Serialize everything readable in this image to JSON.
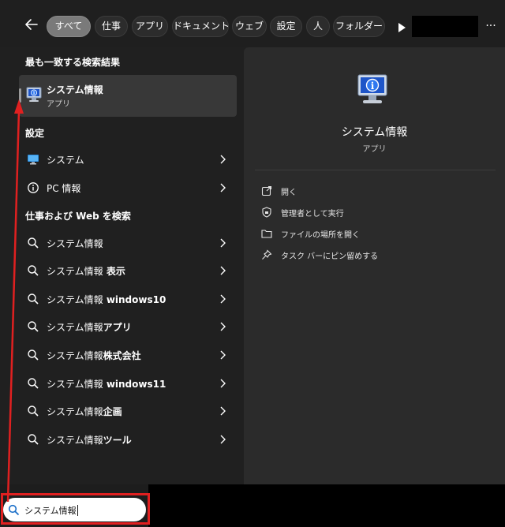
{
  "filters": {
    "back_icon": "arrow-left-icon",
    "chips": [
      {
        "label": "すべて",
        "active": true
      },
      {
        "label": "仕事",
        "active": false
      },
      {
        "label": "アプリ",
        "active": false
      },
      {
        "label": "ドキュメント",
        "active": false
      },
      {
        "label": "ウェブ",
        "active": false
      },
      {
        "label": "設定",
        "active": false
      },
      {
        "label": "人",
        "active": false
      },
      {
        "label": "フォルダー",
        "active": false
      }
    ],
    "more_label": "···"
  },
  "left": {
    "best_match_title": "最も一致する検索結果",
    "best_match": {
      "name": "システム情報",
      "type": "アプリ",
      "icon": "system-information-icon"
    },
    "settings_title": "設定",
    "settings": [
      {
        "label": "システム",
        "icon": "monitor-icon"
      },
      {
        "label": "PC 情報",
        "icon": "info-circle-icon"
      }
    ],
    "web_title": "仕事および Web を検索",
    "web_results": [
      {
        "prefix": "システム情報",
        "suffix": ""
      },
      {
        "prefix": "システム情報",
        "suffix": " 表示"
      },
      {
        "prefix": "システム情報",
        "suffix": " windows10"
      },
      {
        "prefix": "システム情報",
        "suffix": "アプリ"
      },
      {
        "prefix": "システム情報",
        "suffix": "株式会社"
      },
      {
        "prefix": "システム情報",
        "suffix": " windows11"
      },
      {
        "prefix": "システム情報",
        "suffix": "企画"
      },
      {
        "prefix": "システム情報",
        "suffix": "ツール"
      }
    ]
  },
  "right": {
    "title": "システム情報",
    "subtitle": "アプリ",
    "actions": [
      {
        "label": "開く",
        "icon": "open-external-icon"
      },
      {
        "label": "管理者として実行",
        "icon": "shield-admin-icon"
      },
      {
        "label": "ファイルの場所を開く",
        "icon": "folder-icon"
      },
      {
        "label": "タスク バーにピン留めする",
        "icon": "pin-icon"
      }
    ]
  },
  "search": {
    "value": "システム情報"
  },
  "colors": {
    "background": "#202020",
    "panel": "#2b2b2b",
    "annotation": "#e02020",
    "active_chip": "#7a7a7a"
  }
}
